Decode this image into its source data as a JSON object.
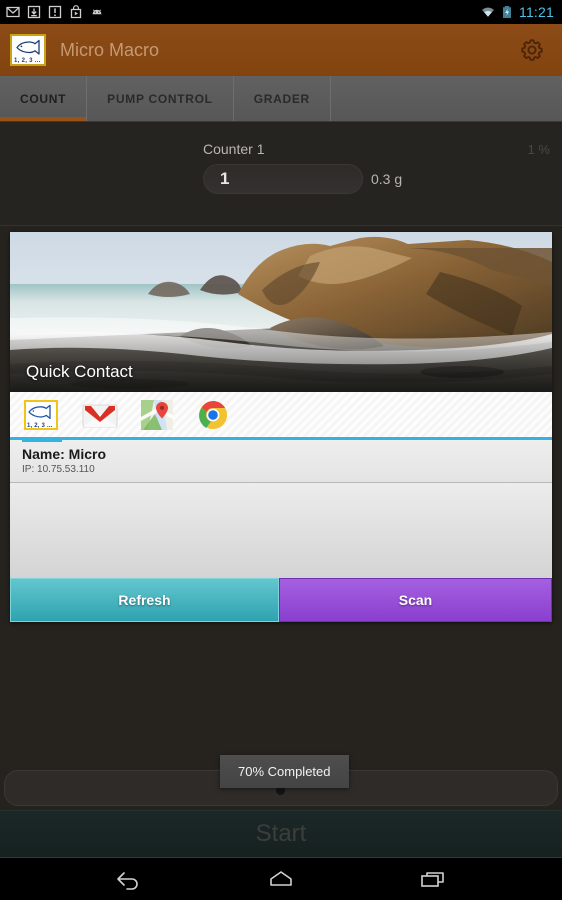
{
  "statusbar": {
    "icons": [
      {
        "name": "gmail-icon"
      },
      {
        "name": "download-icon"
      },
      {
        "name": "alert-icon"
      },
      {
        "name": "play-store-icon"
      },
      {
        "name": "android-icon"
      }
    ],
    "wifi_icon": "wifi-icon",
    "battery_icon": "battery-charging-icon",
    "clock": "11:21",
    "clock_color": "#4dc3e8"
  },
  "actionbar": {
    "logo_icon": "fish-logo-icon",
    "logo_numbers": "1, 2, 3 ...",
    "title": "Micro Macro",
    "settings_icon": "gear-icon",
    "background_color": "#8a4a16",
    "title_color": "#c59a74"
  },
  "tabs": [
    {
      "label": "COUNT",
      "active": true
    },
    {
      "label": "PUMP CONTROL",
      "active": false
    },
    {
      "label": "GRADER",
      "active": false
    }
  ],
  "tab_indicator_color": "#9a5218",
  "counter": {
    "title": "Counter 1",
    "percent": "1 %",
    "value": "1",
    "weight": "0.3 g"
  },
  "quick_contact": {
    "title": "Quick Contact",
    "photo_alt": "beach-rocks-photo",
    "apps": [
      {
        "name": "fish-app-icon",
        "label": "1, 2, 3 ...",
        "selected": true
      },
      {
        "name": "gmail-app-icon",
        "selected": false
      },
      {
        "name": "maps-app-icon",
        "selected": false
      },
      {
        "name": "chrome-app-icon",
        "selected": false
      }
    ],
    "selected_underline_color": "#35b3e0",
    "contact_name": "Name: Micro",
    "contact_ip": "IP: 10.75.53.110",
    "buttons": {
      "refresh": "Refresh",
      "refresh_color": "#3fb2bd",
      "scan": "Scan",
      "scan_color": "#9b53dc"
    }
  },
  "toast": {
    "message": "70% Completed"
  },
  "start_button": {
    "label": "Start"
  },
  "navbar": {
    "back_icon": "back-arrow-icon",
    "home_icon": "home-icon",
    "recents_icon": "recent-apps-icon"
  }
}
